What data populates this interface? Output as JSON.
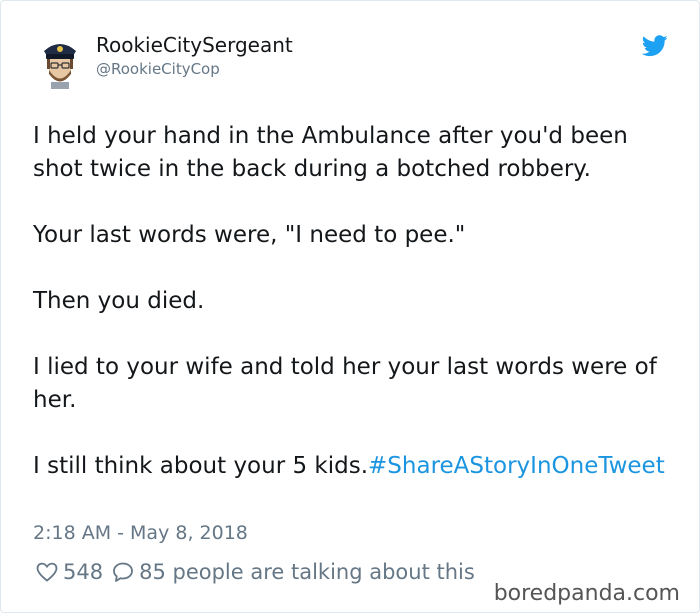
{
  "user": {
    "display_name": "RookieCitySergeant",
    "handle": "@RookieCityCop"
  },
  "tweet": {
    "paragraphs": [
      "I held your hand in the Ambulance after you'd been shot twice in the back during a botched robbery.",
      "Your last words were, \"I need to pee.\"",
      "Then you died.",
      "I lied to your wife and told her your last words were of her.",
      "I still think about your 5 kids."
    ],
    "hashtag": "#ShareAStoryInOneTweet",
    "timestamp": "2:18 AM - May 8, 2018"
  },
  "actions": {
    "like_count": "548",
    "reply_text": "85 people are talking about this"
  },
  "watermark": "boredpanda.com",
  "colors": {
    "text": "#14171a",
    "secondary": "#657786",
    "link": "#1b95e0",
    "twitter_blue": "#1da1f2"
  },
  "icons": {
    "avatar": "police-officer-avatar",
    "brand": "twitter-bird-icon",
    "like": "heart-outline-icon",
    "reply": "speech-bubble-icon"
  }
}
